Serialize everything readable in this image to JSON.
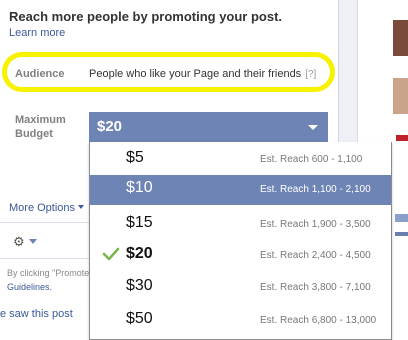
{
  "promo": {
    "heading": "Reach more people by promoting your post.",
    "learn_more": "Learn more",
    "audience_label": "Audience",
    "audience_value": "People who like your Page and their friends",
    "audience_help": "[?]",
    "budget_label": "Maximum Budget",
    "selected_budget": "$20",
    "more_options": "More Options",
    "fine_print_line1": "By clicking \"Promote",
    "fine_print_line2": "Guidelines.",
    "saw_post": "e saw this post"
  },
  "dropdown": {
    "options": [
      {
        "amount": "$5",
        "reach": "Est. Reach 600 - 1,100"
      },
      {
        "amount": "$10",
        "reach": "Est. Reach 1,100 - 2,100"
      },
      {
        "amount": "$15",
        "reach": "Est. Reach 1,900 - 3,500"
      },
      {
        "amount": "$20",
        "reach": "Est. Reach 2,400 - 4,500"
      },
      {
        "amount": "$30",
        "reach": "Est. Reach 3,800 - 7,100"
      },
      {
        "amount": "$50",
        "reach": "Est. Reach 6,800 - 13,000"
      }
    ],
    "hovered_index": 1,
    "checked_index": 3
  },
  "icons": {
    "check": "check-icon",
    "gear": "gear-icon",
    "select_caret": "caret-down-icon"
  },
  "colors": {
    "facebook_blue": "#6d84b4",
    "link_blue": "#3b5998",
    "highlight_yellow": "#f6f200",
    "check_green": "#7ab648"
  }
}
